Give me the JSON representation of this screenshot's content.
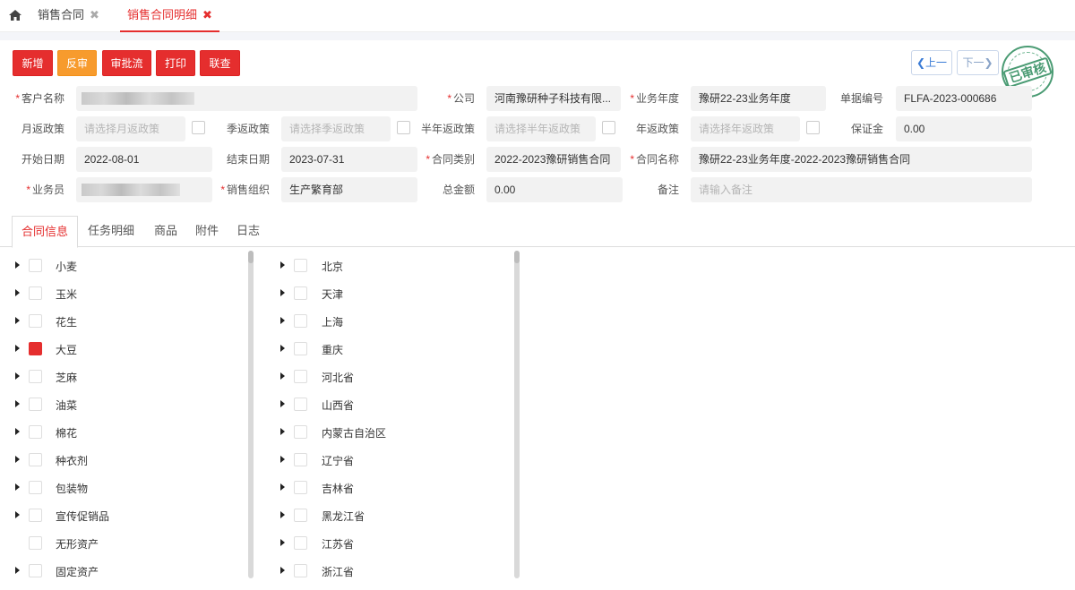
{
  "top_tabs": [
    {
      "label": "销售合同",
      "close": "✖"
    },
    {
      "label": "销售合同明细",
      "close": "✖"
    }
  ],
  "toolbar": {
    "add": "新增",
    "unaudit": "反审",
    "approval_flow": "审批流",
    "print": "打印",
    "linked_query": "联查"
  },
  "nav": {
    "prev": "上一",
    "next": "下一"
  },
  "stamp": {
    "text": "已审核",
    "color": "#4a9b73"
  },
  "form": {
    "customer_name_label": "客户名称",
    "company_label": "公司",
    "company_value": "河南豫研种子科技有限...",
    "business_year_label": "业务年度",
    "business_year_value": "豫研22-23业务年度",
    "doc_no_label": "单据编号",
    "doc_no_value": "FLFA-2023-000686",
    "monthly_rebate_label": "月返政策",
    "monthly_rebate_placeholder": "请选择月返政策",
    "quarterly_rebate_label": "季返政策",
    "quarterly_rebate_placeholder": "请选择季返政策",
    "halfyear_rebate_label": "半年返政策",
    "halfyear_rebate_placeholder": "请选择半年返政策",
    "yearly_rebate_label": "年返政策",
    "yearly_rebate_placeholder": "请选择年返政策",
    "deposit_label": "保证金",
    "deposit_value": "0.00",
    "start_date_label": "开始日期",
    "start_date_value": "2022-08-01",
    "end_date_label": "结束日期",
    "end_date_value": "2023-07-31",
    "contract_type_label": "合同类别",
    "contract_type_value": "2022-2023豫研销售合同",
    "contract_name_label": "合同名称",
    "contract_name_value": "豫研22-23业务年度-2022-2023豫研销售合同",
    "salesman_label": "业务员",
    "sales_org_label": "销售组织",
    "sales_org_value": "生产繁育部",
    "total_amount_label": "总金额",
    "total_amount_value": "0.00",
    "remark_label": "备注",
    "remark_placeholder": "请输入备注"
  },
  "detail_tabs": [
    "合同信息",
    "任务明细",
    "商品",
    "附件",
    "日志"
  ],
  "product_tree": [
    {
      "label": "小麦",
      "expandable": true,
      "checked": false
    },
    {
      "label": "玉米",
      "expandable": true,
      "checked": false
    },
    {
      "label": "花生",
      "expandable": true,
      "checked": false
    },
    {
      "label": "大豆",
      "expandable": true,
      "checked": true
    },
    {
      "label": "芝麻",
      "expandable": true,
      "checked": false
    },
    {
      "label": "油菜",
      "expandable": true,
      "checked": false
    },
    {
      "label": "棉花",
      "expandable": true,
      "checked": false
    },
    {
      "label": "种衣剂",
      "expandable": true,
      "checked": false
    },
    {
      "label": "包装物",
      "expandable": true,
      "checked": false
    },
    {
      "label": "宣传促销品",
      "expandable": true,
      "checked": false
    },
    {
      "label": "无形资产",
      "expandable": false,
      "checked": false
    },
    {
      "label": "固定资产",
      "expandable": true,
      "checked": false
    }
  ],
  "region_tree": [
    {
      "label": "北京",
      "expandable": true,
      "checked": false
    },
    {
      "label": "天津",
      "expandable": true,
      "checked": false
    },
    {
      "label": "上海",
      "expandable": true,
      "checked": false
    },
    {
      "label": "重庆",
      "expandable": true,
      "checked": false
    },
    {
      "label": "河北省",
      "expandable": true,
      "checked": false
    },
    {
      "label": "山西省",
      "expandable": true,
      "checked": false
    },
    {
      "label": "内蒙古自治区",
      "expandable": true,
      "checked": false
    },
    {
      "label": "辽宁省",
      "expandable": true,
      "checked": false
    },
    {
      "label": "吉林省",
      "expandable": true,
      "checked": false
    },
    {
      "label": "黑龙江省",
      "expandable": true,
      "checked": false
    },
    {
      "label": "江苏省",
      "expandable": true,
      "checked": false
    },
    {
      "label": "浙江省",
      "expandable": true,
      "checked": false
    }
  ]
}
